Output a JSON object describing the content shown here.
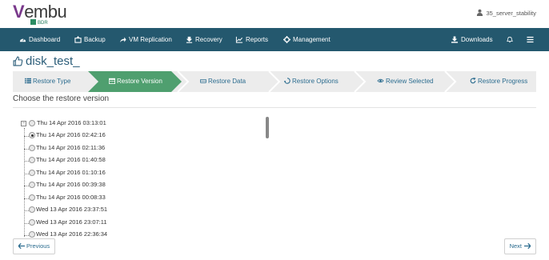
{
  "brand": {
    "name": "Vembu",
    "product": "BDR"
  },
  "user": {
    "name": "35_server_stability"
  },
  "nav": {
    "items": [
      "Dashboard",
      "Backup",
      "VM Replication",
      "Recovery",
      "Reports",
      "Management"
    ],
    "downloads": "Downloads"
  },
  "page": {
    "title": "disk_test_"
  },
  "wizard": {
    "steps": [
      "Restore Type",
      "Restore Version",
      "Restore Data",
      "Restore Options",
      "Review Selected",
      "Restore Progress"
    ],
    "active_index": 1
  },
  "section_label": "Choose the restore version",
  "versions": {
    "root": "Thu 14 Apr 2016 03:13:01",
    "children": [
      "Thu 14 Apr 2016 02:42:16",
      "Thu 14 Apr 2016 02:11:36",
      "Thu 14 Apr 2016 01:40:58",
      "Thu 14 Apr 2016 01:10:16",
      "Thu 14 Apr 2016 00:39:38",
      "Thu 14 Apr 2016 00:08:33",
      "Wed 13 Apr 2016 23:37:51",
      "Wed 13 Apr 2016 23:07:11",
      "Wed 13 Apr 2016 22:36:34"
    ],
    "selected_index": 0
  },
  "buttons": {
    "previous": "Previous",
    "next": "Next"
  },
  "colors": {
    "nav": "#24586e",
    "active_step": "#4f9f6f",
    "step_bg": "#ececec",
    "link": "#2b6c8f"
  }
}
